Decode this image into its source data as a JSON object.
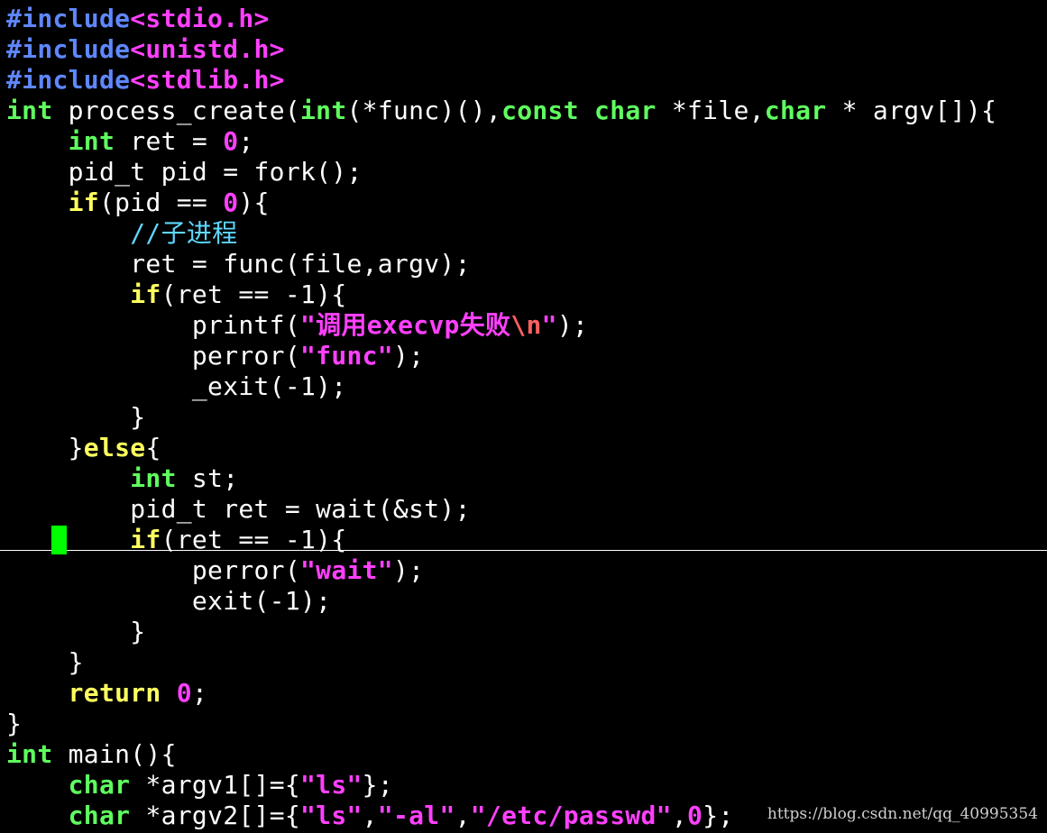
{
  "editor": {
    "language": "c",
    "lines": [
      [
        [
          "preproc",
          "#include"
        ],
        [
          "header",
          "<stdio.h>"
        ]
      ],
      [
        [
          "preproc",
          "#include"
        ],
        [
          "header",
          "<unistd.h>"
        ]
      ],
      [
        [
          "preproc",
          "#include"
        ],
        [
          "header",
          "<stdlib.h>"
        ]
      ],
      [
        [
          "type",
          "int"
        ],
        [
          "normal",
          " process_create("
        ],
        [
          "type",
          "int"
        ],
        [
          "normal",
          "(*func)(),"
        ],
        [
          "type",
          "const"
        ],
        [
          "normal",
          " "
        ],
        [
          "type",
          "char"
        ],
        [
          "normal",
          " *file,"
        ],
        [
          "type",
          "char"
        ],
        [
          "normal",
          " * argv[]){"
        ]
      ],
      [
        [
          "normal",
          "    "
        ],
        [
          "type",
          "int"
        ],
        [
          "normal",
          " ret = "
        ],
        [
          "number",
          "0"
        ],
        [
          "normal",
          ";"
        ]
      ],
      [
        [
          "normal",
          "    pid_t pid = fork();"
        ]
      ],
      [
        [
          "normal",
          "    "
        ],
        [
          "keyword",
          "if"
        ],
        [
          "normal",
          "(pid == "
        ],
        [
          "number",
          "0"
        ],
        [
          "normal",
          "){"
        ]
      ],
      [
        [
          "normal",
          "        "
        ],
        [
          "comment",
          "//子进程"
        ]
      ],
      [
        [
          "normal",
          "        ret = func(file,argv);"
        ]
      ],
      [
        [
          "normal",
          "        "
        ],
        [
          "keyword",
          "if"
        ],
        [
          "normal",
          "(ret == -1){"
        ]
      ],
      [
        [
          "normal",
          "            printf("
        ],
        [
          "string",
          "\"调用execvp失败"
        ],
        [
          "special",
          "\\n"
        ],
        [
          "string",
          "\""
        ],
        [
          "normal",
          ");"
        ]
      ],
      [
        [
          "normal",
          "            perror("
        ],
        [
          "string",
          "\"func\""
        ],
        [
          "normal",
          ");"
        ]
      ],
      [
        [
          "normal",
          "            _exit(-1);"
        ]
      ],
      [
        [
          "normal",
          "        }"
        ]
      ],
      [
        [
          "normal",
          "    }"
        ],
        [
          "keyword",
          "else"
        ],
        [
          "normal",
          "{"
        ]
      ],
      [
        [
          "normal",
          "        "
        ],
        [
          "type",
          "int"
        ],
        [
          "normal",
          " st;"
        ]
      ],
      [
        [
          "normal",
          "        pid_t ret = wait(&st);"
        ]
      ],
      [
        [
          "normal",
          "        "
        ],
        [
          "keyword",
          "if"
        ],
        [
          "normal",
          "(ret == -1){"
        ]
      ],
      [
        [
          "normal",
          "            perror("
        ],
        [
          "string",
          "\"wait\""
        ],
        [
          "normal",
          ");"
        ]
      ],
      [
        [
          "normal",
          "            exit(-1);"
        ]
      ],
      [
        [
          "normal",
          "        }"
        ]
      ],
      [
        [
          "normal",
          "    }"
        ]
      ],
      [
        [
          "normal",
          "    "
        ],
        [
          "keyword",
          "return"
        ],
        [
          "normal",
          " "
        ],
        [
          "number",
          "0"
        ],
        [
          "normal",
          ";"
        ]
      ],
      [
        [
          "normal",
          "}"
        ]
      ],
      [
        [
          "type",
          "int"
        ],
        [
          "normal",
          " main(){"
        ]
      ],
      [
        [
          "normal",
          "    "
        ],
        [
          "type",
          "char"
        ],
        [
          "normal",
          " *argv1[]={"
        ],
        [
          "string",
          "\"ls\""
        ],
        [
          "normal",
          "};"
        ]
      ],
      [
        [
          "normal",
          "    "
        ],
        [
          "type",
          "char"
        ],
        [
          "normal",
          " *argv2[]={"
        ],
        [
          "string",
          "\"ls\""
        ],
        [
          "normal",
          ","
        ],
        [
          "string",
          "\"-al\""
        ],
        [
          "normal",
          ","
        ],
        [
          "string",
          "\"/etc/passwd\""
        ],
        [
          "normal",
          ","
        ],
        [
          "number",
          "0"
        ],
        [
          "normal",
          "};"
        ]
      ]
    ],
    "colors": {
      "background": "#000000",
      "preproc": "#5f87ff",
      "header": "#ff40ff",
      "type": "#5fff5f",
      "keyword": "#ffff5f",
      "number": "#ff40ff",
      "string": "#ff40ff",
      "special": "#ff5f5f",
      "comment": "#5fd7ff",
      "normal": "#ffffff",
      "cursor": "#00ff00"
    }
  },
  "watermark": {
    "text": "https://blog.csdn.net/qq_40995354"
  }
}
